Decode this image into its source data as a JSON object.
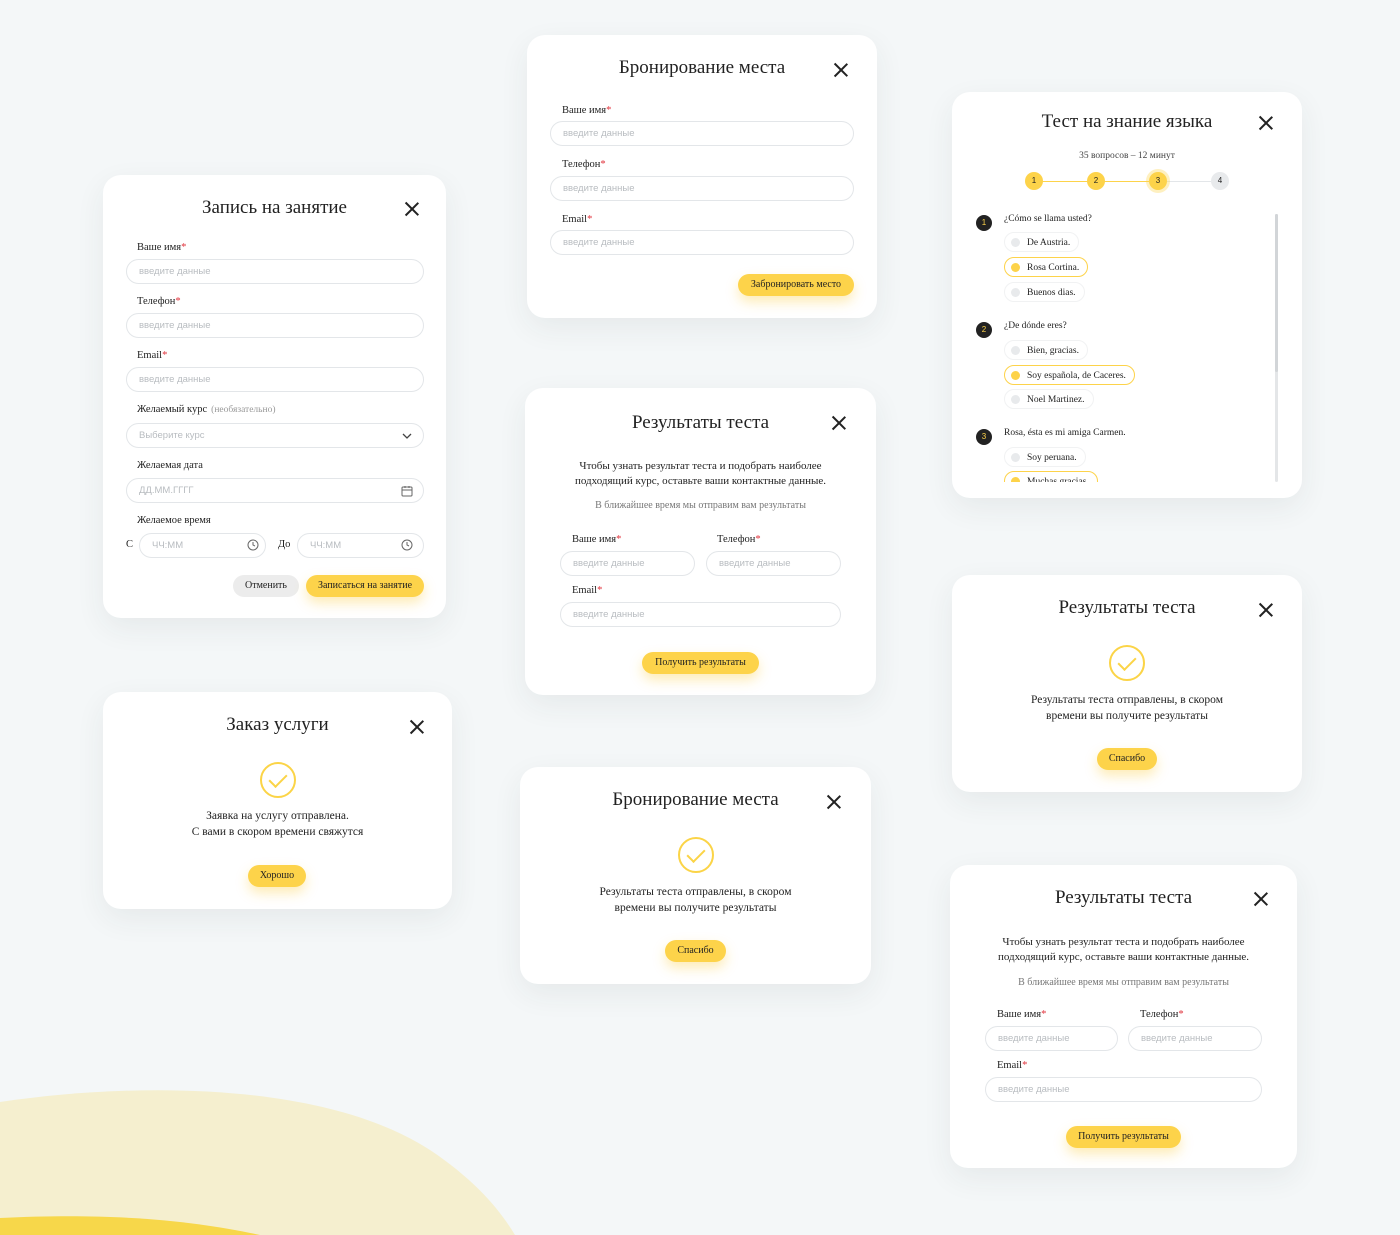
{
  "labels": {
    "name": "Ваше имя",
    "phone": "Телефон",
    "email": "Email",
    "required": "*",
    "placeholder": "введите данные"
  },
  "lesson_form": {
    "title": "Запись на занятие",
    "course_label": "Желаемый курс",
    "course_optional": "(необязательно)",
    "course_placeholder": "Выберите курс",
    "date_label": "Желаемая дата",
    "date_placeholder": "ДД.ММ.ГГГГ",
    "time_label": "Желаемое время",
    "from_label": "С",
    "to_label": "До",
    "time_placeholder": "ЧЧ:ММ",
    "cancel_label": "Отменить",
    "submit_label": "Записаться на занятие"
  },
  "service_order": {
    "title": "Заказ услуги",
    "line1": "Заявка на услугу отправлена.",
    "line2": "С вами в скором времени свяжутся",
    "button": "Хорошо"
  },
  "booking_form": {
    "title": "Бронирование места",
    "submit_label": "Забронировать место"
  },
  "test_results_form": {
    "title": "Результаты теста",
    "line1": "Чтобы узнать результат теста и подобрать наиболее",
    "line2": "подходящий курс, оставьте ваши контактные данные.",
    "note": "В ближайшее время мы отправим вам результаты",
    "submit_label": "Получить результаты"
  },
  "booking_success": {
    "title": "Бронирование места",
    "line1": "Результаты теста отправлены, в скором",
    "line2": "времени вы получите результаты",
    "button": "Спасибо"
  },
  "language_test": {
    "title": "Тест на знание языка",
    "meta": "35 вопросов – 12 минут",
    "steps": [
      "1",
      "2",
      "3",
      "4"
    ],
    "questions": [
      {
        "num": "1",
        "text": "¿Cómo se llama usted?",
        "answers": [
          "De Austria.",
          "Rosa Cortina.",
          "Buenos dias."
        ],
        "selected": 1
      },
      {
        "num": "2",
        "text": "¿De dónde eres?",
        "answers": [
          "Bien, gracias.",
          "Soy española, de Caceres.",
          "Noel Martinez."
        ],
        "selected": 1
      },
      {
        "num": "3",
        "text": "Rosa, ésta es mi amiga Carmen.",
        "answers": [
          "Soy peruana.",
          "Muchas gracias."
        ],
        "selected": 1
      }
    ]
  },
  "test_results_success": {
    "title": "Результаты теста",
    "line1": "Результаты теста отправлены, в скором",
    "line2": "времени вы получите результаты",
    "button": "Спасибо"
  },
  "test_results_form_2": {
    "title": "Результаты теста",
    "line1": "Чтобы узнать результат теста и подобрать наиболее",
    "line2": "подходящий курс, оставьте ваши контактные данные.",
    "note": "В ближайшее время мы отправим вам результаты",
    "submit_label": "Получить результаты"
  },
  "colors": {
    "accent": "#fdd34a",
    "required": "#e0323b",
    "background": "#f4f7f8",
    "blob": "#f5efcf"
  },
  "icons": [
    "close-icon",
    "chevron-down-icon",
    "calendar-icon",
    "clock-icon",
    "check-circle-icon"
  ]
}
